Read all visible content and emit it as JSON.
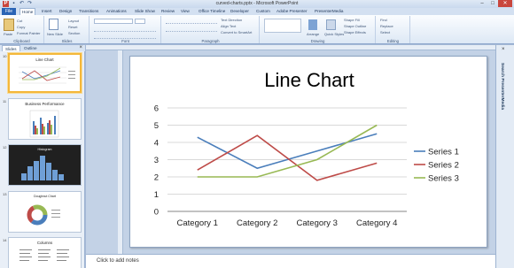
{
  "window": {
    "title": "curved-charts.pptx - Microsoft PowerPoint"
  },
  "tabs": {
    "file": "File",
    "items": [
      "Home",
      "Insert",
      "Design",
      "Transitions",
      "Animations",
      "Slide Show",
      "Review",
      "View",
      "Office Timeline",
      "Developer",
      "Custom",
      "Adobe Presenter",
      "PresenterMedia"
    ],
    "active": "Home"
  },
  "ribbon": {
    "clipboard": {
      "label": "Clipboard",
      "paste": "Paste",
      "cut": "Cut",
      "copy": "Copy",
      "format_painter": "Format Painter"
    },
    "slides": {
      "label": "Slides",
      "new_slide": "New Slide",
      "layout": "Layout",
      "reset": "Reset",
      "section": "Section"
    },
    "font": {
      "label": "Font"
    },
    "paragraph": {
      "label": "Paragraph",
      "text_direction": "Text Direction",
      "align_text": "Align Text",
      "smartart": "Convert to SmartArt"
    },
    "drawing": {
      "label": "Drawing",
      "arrange": "Arrange",
      "quick_styles": "Quick Styles",
      "shape_fill": "Shape Fill",
      "shape_outline": "Shape Outline",
      "shape_effects": "Shape Effects"
    },
    "editing": {
      "label": "Editing",
      "find": "Find",
      "replace": "Replace",
      "select": "Select"
    }
  },
  "panel": {
    "tabs": [
      "Slides",
      "Outline"
    ],
    "close": "×",
    "thumbnails": [
      {
        "num": "10",
        "title": "Line Chart"
      },
      {
        "num": "11",
        "title": "Business Performance"
      },
      {
        "num": "12",
        "title": "Histogram"
      },
      {
        "num": "13",
        "title": "Doughnut Chart"
      },
      {
        "num": "14",
        "title": "Columns"
      }
    ]
  },
  "slide": {
    "title": "Line Chart"
  },
  "chart_data": {
    "type": "line",
    "categories": [
      "Category 1",
      "Category 2",
      "Category 3",
      "Category 4"
    ],
    "series": [
      {
        "name": "Series 1",
        "values": [
          4.3,
          2.5,
          3.5,
          4.5
        ],
        "color": "#4a7ebb"
      },
      {
        "name": "Series 2",
        "values": [
          2.4,
          4.4,
          1.8,
          2.8
        ],
        "color": "#be4b48"
      },
      {
        "name": "Series 3",
        "values": [
          2.0,
          2.0,
          3.0,
          5.0
        ],
        "color": "#98b954"
      }
    ],
    "yticks": [
      "0",
      "1",
      "2",
      "3",
      "4",
      "5",
      "6"
    ],
    "ylim": [
      0,
      6
    ],
    "grid": true,
    "legend": "right"
  },
  "rightpane": {
    "title": "Search PresenterMedia",
    "close": "×"
  },
  "notes": {
    "placeholder": "Click to add notes"
  }
}
